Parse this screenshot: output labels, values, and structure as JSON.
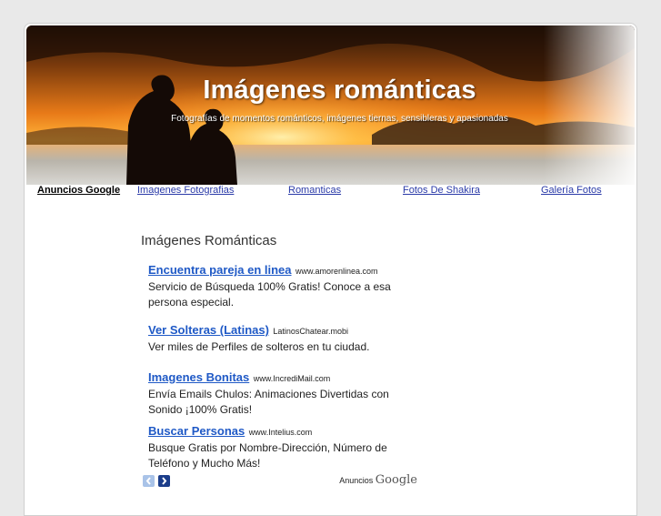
{
  "header": {
    "title": "Imágenes románticas",
    "tagline": "Fotografías de momentos románticos, imágenes tiernas, sensibleras y apasionadas"
  },
  "nav": {
    "label": "Anuncios Google",
    "links": [
      {
        "label": "Imagenes Fotografias"
      },
      {
        "label": "Romanticas"
      },
      {
        "label": "Fotos De Shakira"
      },
      {
        "label": "Galería Fotos"
      }
    ]
  },
  "ads": {
    "heading": "Imágenes Románticas",
    "items": [
      {
        "title": "Encuentra pareja en linea",
        "url": "www.amorenlinea.com",
        "desc": "Servicio de Búsqueda 100% Gratis! Conoce a esa persona especial."
      },
      {
        "title": "Ver Solteras (Latinas)",
        "url": "LatinosChatear.mobi",
        "desc": "Ver miles de Perfiles de solteros en tu ciudad."
      },
      {
        "title": "Imagenes Bonitas",
        "url": "www.IncrediMail.com",
        "desc": "Envía Emails Chulos: Animaciones Divertidas con Sonido ¡100% Gratis!"
      },
      {
        "title": "Buscar Personas",
        "url": "www.Intelius.com",
        "desc": "Busque Gratis por Nombre-Dirección, Número de Teléfono y Mucho Más!"
      }
    ],
    "footer_label": "Anuncios",
    "footer_brand": "Google"
  },
  "colors": {
    "page_bg": "#e9e9e9",
    "link": "#2a3aa8",
    "ad_link": "#1f59c6",
    "sunset_orange": "#f08a1c"
  },
  "icons": {
    "prev": "chevron-left-icon",
    "next": "chevron-right-icon"
  }
}
